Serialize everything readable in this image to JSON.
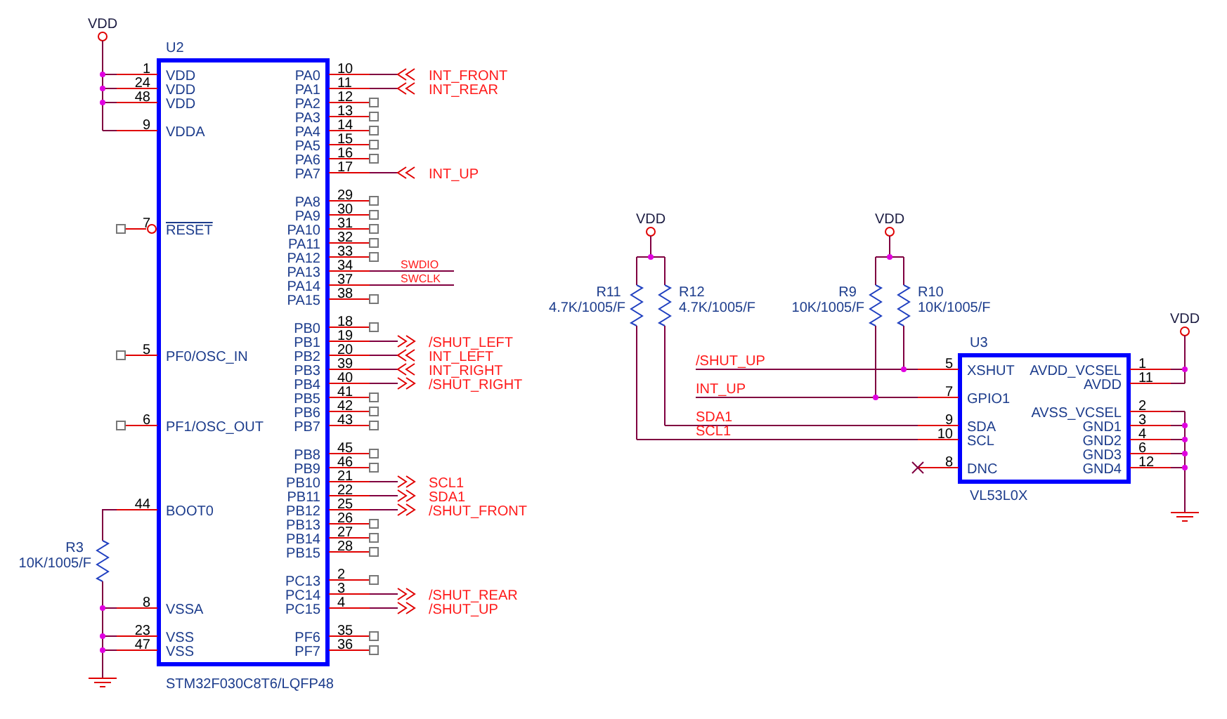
{
  "u2": {
    "ref": "U2",
    "part": "STM32F030C8T6/LQFP48",
    "left_pins": [
      {
        "number": "1",
        "name": "VDD",
        "kind": "power"
      },
      {
        "number": "24",
        "name": "VDD",
        "kind": "power"
      },
      {
        "number": "48",
        "name": "VDD",
        "kind": "power"
      },
      {
        "number": "9",
        "name": "VDDA",
        "kind": "power"
      },
      {
        "number": "7",
        "name": "RESET",
        "kind": "inverted_no_connect"
      },
      {
        "number": "5",
        "name": "PF0/OSC_IN",
        "kind": "no_connect"
      },
      {
        "number": "6",
        "name": "PF1/OSC_OUT",
        "kind": "no_connect"
      },
      {
        "number": "44",
        "name": "BOOT0",
        "kind": "pulldown"
      },
      {
        "number": "8",
        "name": "VSSA",
        "kind": "ground"
      },
      {
        "number": "23",
        "name": "VSS",
        "kind": "ground"
      },
      {
        "number": "47",
        "name": "VSS",
        "kind": "ground"
      }
    ],
    "right_pins": [
      {
        "number": "10",
        "name": "PA0",
        "kind": "input",
        "net": "INT_FRONT"
      },
      {
        "number": "11",
        "name": "PA1",
        "kind": "input",
        "net": "INT_REAR"
      },
      {
        "number": "12",
        "name": "PA2",
        "kind": "no_connect"
      },
      {
        "number": "13",
        "name": "PA3",
        "kind": "no_connect"
      },
      {
        "number": "14",
        "name": "PA4",
        "kind": "no_connect"
      },
      {
        "number": "15",
        "name": "PA5",
        "kind": "no_connect"
      },
      {
        "number": "16",
        "name": "PA6",
        "kind": "no_connect"
      },
      {
        "number": "17",
        "name": "PA7",
        "kind": "input",
        "net": "INT_UP"
      },
      {
        "number": "29",
        "name": "PA8",
        "kind": "no_connect"
      },
      {
        "number": "30",
        "name": "PA9",
        "kind": "no_connect"
      },
      {
        "number": "31",
        "name": "PA10",
        "kind": "no_connect"
      },
      {
        "number": "32",
        "name": "PA11",
        "kind": "no_connect"
      },
      {
        "number": "33",
        "name": "PA12",
        "kind": "no_connect"
      },
      {
        "number": "34",
        "name": "PA13",
        "kind": "wire",
        "net": "SWDIO"
      },
      {
        "number": "37",
        "name": "PA14",
        "kind": "wire",
        "net": "SWCLK"
      },
      {
        "number": "38",
        "name": "PA15",
        "kind": "no_connect"
      },
      {
        "number": "18",
        "name": "PB0",
        "kind": "no_connect"
      },
      {
        "number": "19",
        "name": "PB1",
        "kind": "output",
        "net": "/SHUT_LEFT"
      },
      {
        "number": "20",
        "name": "PB2",
        "kind": "input",
        "net": "INT_LEFT"
      },
      {
        "number": "39",
        "name": "PB3",
        "kind": "input",
        "net": "INT_RIGHT"
      },
      {
        "number": "40",
        "name": "PB4",
        "kind": "output",
        "net": "/SHUT_RIGHT"
      },
      {
        "number": "41",
        "name": "PB5",
        "kind": "no_connect"
      },
      {
        "number": "42",
        "name": "PB6",
        "kind": "no_connect"
      },
      {
        "number": "43",
        "name": "PB7",
        "kind": "no_connect"
      },
      {
        "number": "45",
        "name": "PB8",
        "kind": "no_connect"
      },
      {
        "number": "46",
        "name": "PB9",
        "kind": "no_connect"
      },
      {
        "number": "21",
        "name": "PB10",
        "kind": "output",
        "net": "SCL1"
      },
      {
        "number": "22",
        "name": "PB11",
        "kind": "output",
        "net": "SDA1"
      },
      {
        "number": "25",
        "name": "PB12",
        "kind": "output",
        "net": "/SHUT_FRONT"
      },
      {
        "number": "26",
        "name": "PB13",
        "kind": "no_connect"
      },
      {
        "number": "27",
        "name": "PB14",
        "kind": "no_connect"
      },
      {
        "number": "28",
        "name": "PB15",
        "kind": "no_connect"
      },
      {
        "number": "2",
        "name": "PC13",
        "kind": "no_connect"
      },
      {
        "number": "3",
        "name": "PC14",
        "kind": "output",
        "net": "/SHUT_REAR"
      },
      {
        "number": "4",
        "name": "PC15",
        "kind": "output",
        "net": "/SHUT_UP"
      },
      {
        "number": "35",
        "name": "PF6",
        "kind": "no_connect"
      },
      {
        "number": "36",
        "name": "PF7",
        "kind": "no_connect"
      }
    ]
  },
  "u3": {
    "ref": "U3",
    "part": "VL53L0X",
    "left_pins": [
      {
        "number": "5",
        "name": "XSHUT",
        "kind": "net",
        "net": "/SHUT_UP"
      },
      {
        "number": "7",
        "name": "GPIO1",
        "kind": "net",
        "net": "INT_UP"
      },
      {
        "number": "9",
        "name": "SDA",
        "kind": "net",
        "net": "SDA1"
      },
      {
        "number": "10",
        "name": "SCL",
        "kind": "net",
        "net": "SCL1"
      },
      {
        "number": "8",
        "name": "DNC",
        "kind": "no_connect"
      }
    ],
    "right_pins": [
      {
        "number": "1",
        "name": "AVDD_VCSEL",
        "kind": "power"
      },
      {
        "number": "11",
        "name": "AVDD",
        "kind": "power"
      },
      {
        "number": "2",
        "name": "AVSS_VCSEL",
        "kind": "ground"
      },
      {
        "number": "3",
        "name": "GND1",
        "kind": "ground"
      },
      {
        "number": "4",
        "name": "GND2",
        "kind": "ground"
      },
      {
        "number": "6",
        "name": "GND3",
        "kind": "ground"
      },
      {
        "number": "12",
        "name": "GND4",
        "kind": "ground"
      }
    ]
  },
  "resistors": [
    {
      "ref": "R3",
      "value": "10K/1005/F"
    },
    {
      "ref": "R11",
      "value": "4.7K/1005/F"
    },
    {
      "ref": "R12",
      "value": "4.7K/1005/F"
    },
    {
      "ref": "R9",
      "value": "10K/1005/F"
    },
    {
      "ref": "R10",
      "value": "10K/1005/F"
    }
  ],
  "power_ports": [
    {
      "label": "VDD"
    },
    {
      "label": "VDD"
    },
    {
      "label": "VDD"
    },
    {
      "label": "VDD"
    }
  ]
}
